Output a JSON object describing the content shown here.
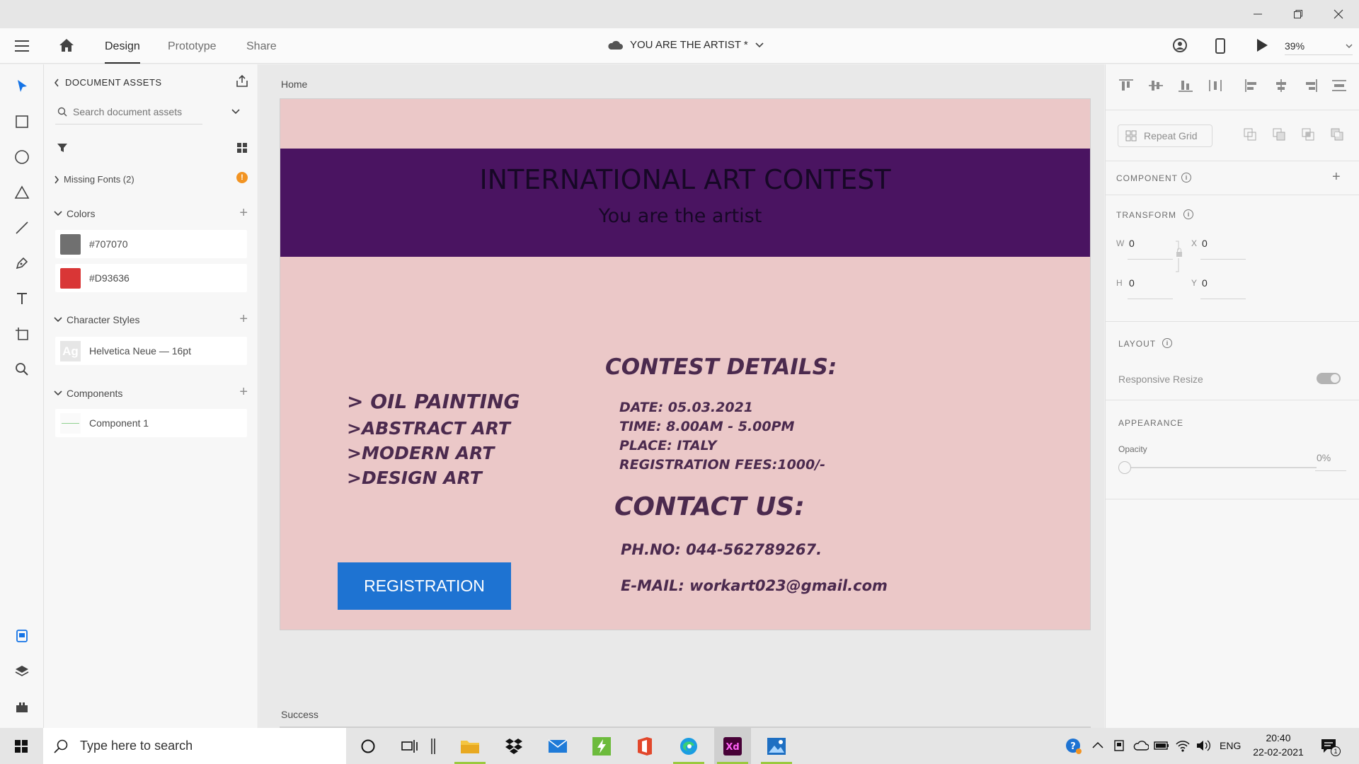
{
  "app": {
    "document_title": "YOU ARE THE ARTIST *",
    "zoom": "39%",
    "tabs": [
      "Design",
      "Prototype",
      "Share"
    ]
  },
  "assets_panel": {
    "header": "DOCUMENT ASSETS",
    "search_placeholder": "Search document assets",
    "missing_fonts": "Missing Fonts (2)",
    "colors_label": "Colors",
    "colors": [
      {
        "hex": "#707070",
        "label": "#707070"
      },
      {
        "hex": "#D93636",
        "label": "#D93636"
      }
    ],
    "char_styles_label": "Character Styles",
    "char_styles": [
      {
        "sample": "Ag",
        "label": "Helvetica Neue — 16pt"
      }
    ],
    "components_label": "Components",
    "components": [
      {
        "label": "Component 1"
      }
    ]
  },
  "canvas": {
    "artboard_name": "Home",
    "second_artboard_name": "Success",
    "artboard": {
      "title": "INTERNATIONAL ART CONTEST",
      "subtitle": "You are the artist",
      "categories": [
        "> OIL PAINTING",
        ">ABSTRACT ART",
        ">MODERN ART",
        ">DESIGN ART"
      ],
      "details_heading": "CONTEST DETAILS:",
      "details": [
        "DATE: 05.03.2021",
        "TIME: 8.00AM - 5.00PM",
        "PLACE: ITALY",
        "REGISTRATION FEES:1000/-"
      ],
      "contact_heading": "CONTACT US:",
      "phone": "PH.NO: 044-562789267.",
      "email": "E-MAIL: workart023@gmail.com",
      "button": "REGISTRATION",
      "colors": {
        "background": "#ebc8c8",
        "banner": "#4a1461",
        "button": "#1e73d2"
      }
    }
  },
  "properties": {
    "repeat_grid": "Repeat Grid",
    "component_label": "COMPONENT",
    "transform_label": "TRANSFORM",
    "w_label": "W",
    "w_value": "0",
    "h_label": "H",
    "h_value": "0",
    "x_label": "X",
    "x_value": "0",
    "y_label": "Y",
    "y_value": "0",
    "layout_label": "LAYOUT",
    "responsive_resize": "Responsive Resize",
    "appearance_label": "APPEARANCE",
    "opacity_label": "Opacity",
    "opacity_value": "0%"
  },
  "taskbar": {
    "search_placeholder": "Type here to search",
    "language": "ENG",
    "time": "20:40",
    "date": "22-02-2021",
    "notification_count": "1"
  }
}
